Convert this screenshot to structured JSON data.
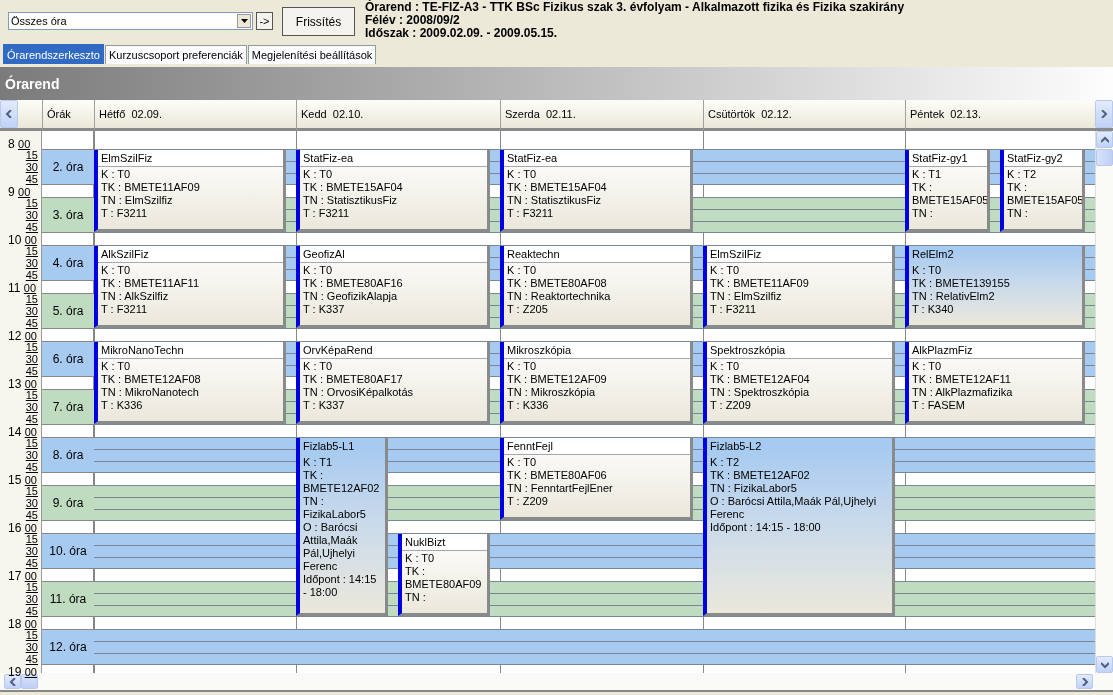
{
  "toolbar": {
    "filter": {
      "value": "Összes óra"
    },
    "go_button": "->",
    "refresh_button": "Frissítés",
    "info": [
      "Órarend : TE-FIZ-A3 - TTK BSc Fizikus szak 3. évfolyam - Alkalmazott fizika és Fizika szakirány",
      "Félév : 2008/09/2",
      "Időszak : 2009.02.09. - 2009.05.15."
    ]
  },
  "tabs": [
    {
      "label": "Órarendszerkeszto",
      "selected": true
    },
    {
      "label": "Kurzuscsoport preferenciák",
      "selected": false
    },
    {
      "label": "Megjelenítési beállítások",
      "selected": false
    }
  ],
  "panel_title": "Órarend",
  "timetable": {
    "periods_heading": "Órák",
    "hours": [
      {
        "hour": "8",
        "minute": "00",
        "quarters": [
          "15",
          "30",
          "45"
        ]
      },
      {
        "hour": "9",
        "minute": "00",
        "quarters": [
          "15",
          "30",
          "45"
        ]
      },
      {
        "hour": "10",
        "minute": "00",
        "quarters": [
          "15",
          "30",
          "45"
        ]
      },
      {
        "hour": "11",
        "minute": "00",
        "quarters": [
          "15",
          "30",
          "45"
        ]
      },
      {
        "hour": "12",
        "minute": "00",
        "quarters": [
          "15",
          "30",
          "45"
        ]
      },
      {
        "hour": "13",
        "minute": "00",
        "quarters": [
          "15",
          "30",
          "45"
        ]
      },
      {
        "hour": "14",
        "minute": "00",
        "quarters": [
          "15",
          "30",
          "45"
        ]
      },
      {
        "hour": "15",
        "minute": "00",
        "quarters": [
          "15",
          "30",
          "45"
        ]
      },
      {
        "hour": "16",
        "minute": "00",
        "quarters": [
          "15",
          "30",
          "45"
        ]
      },
      {
        "hour": "17",
        "minute": "00",
        "quarters": [
          "15",
          "30",
          "45"
        ]
      },
      {
        "hour": "18",
        "minute": "00",
        "quarters": [
          "15",
          "30",
          "45"
        ]
      },
      {
        "hour": "19",
        "minute": "00"
      }
    ],
    "periods": [
      {
        "label": "2. óra",
        "color": "#a6caf0"
      },
      {
        "label": "3. óra",
        "color": "#c0dcc0"
      },
      {
        "label": "4. óra",
        "color": "#a6caf0"
      },
      {
        "label": "5. óra",
        "color": "#c0dcc0"
      },
      {
        "label": "6. óra",
        "color": "#a6caf0"
      },
      {
        "label": "7. óra",
        "color": "#c0dcc0"
      },
      {
        "label": "8. óra",
        "color": "#a6caf0"
      },
      {
        "label": "9. óra",
        "color": "#c0dcc0"
      },
      {
        "label": "10. óra",
        "color": "#a6caf0"
      },
      {
        "label": "11. óra",
        "color": "#c0dcc0"
      },
      {
        "label": "12. óra",
        "color": "#a6caf0"
      }
    ],
    "days": [
      {
        "name": "Hétfő",
        "date": "02.09.",
        "blocks": [
          {
            "kind": "booked",
            "events": [
              {
                "title": "ElmSzilFiz",
                "kind": "double",
                "highlighted": false,
                "lines": [
                  "K : T0",
                  "TK : BMETE11AF09",
                  "TN : ElmSzilfiz",
                  "T : F3211"
                ]
              }
            ]
          },
          {
            "kind": "booked",
            "events": [
              {
                "title": "AlkSzilFiz",
                "kind": "double",
                "highlighted": false,
                "lines": [
                  "K : T0",
                  "TK : BMETE11AF11",
                  "TN : AlkSzilfiz",
                  "T : F3211"
                ]
              }
            ]
          },
          {
            "kind": "booked",
            "events": [
              {
                "title": "MikroNanoTechn",
                "kind": "double",
                "highlighted": false,
                "lines": [
                  "K : T0",
                  "TK : BMETE12AF08",
                  "TN : MikroNanotech",
                  "T : K336"
                ]
              }
            ]
          }
        ]
      },
      {
        "name": "Kedd",
        "date": "02.10.",
        "blocks": [
          {
            "kind": "booked",
            "events": [
              {
                "title": "StatFiz-ea",
                "kind": "double",
                "highlighted": false,
                "lines": [
                  "K : T0",
                  "TK : BMETE15AF04",
                  "TN : StatisztikusFiz",
                  "T : F3211"
                ]
              }
            ]
          },
          {
            "kind": "booked",
            "events": [
              {
                "title": "GeofizAl",
                "kind": "double",
                "highlighted": false,
                "lines": [
                  "K : T0",
                  "TK : BMETE80AF16",
                  "TN : GeofizikAlapja",
                  "T : K337"
                ]
              }
            ]
          },
          {
            "kind": "booked",
            "events": [
              {
                "title": "OrvKépaRend",
                "kind": "double",
                "highlighted": false,
                "lines": [
                  "K : T0",
                  "TK : BMETE80AF17",
                  "TN : OrvosiKépalkotás",
                  "T : K337"
                ]
              }
            ]
          },
          {
            "kind": "booked",
            "events": [
              {
                "title": "Fizlab5-L1",
                "kind": "quadruple",
                "highlighted": true,
                "lines": [
                  "K : T1",
                  "TK : BMETE12AF02",
                  "TN : FizikaLabor5",
                  "O : Barócsi Attila,Maák Pál,Ujhelyi Ferenc",
                  "Időpont : 14:15 - 18:00"
                ]
              }
            ]
          },
          {
            "kind": "booked",
            "events": [
              {
                "title": "NuklBizt",
                "kind": "double",
                "highlighted": false,
                "lines": [
                  "K : T0",
                  "TK : BMETE80AF09",
                  "TN :"
                ]
              }
            ]
          }
        ]
      },
      {
        "name": "Szerda",
        "date": "02.11.",
        "blocks": [
          {
            "kind": "booked",
            "events": [
              {
                "title": "StatFiz-ea",
                "kind": "double",
                "highlighted": false,
                "lines": [
                  "K : T0",
                  "TK : BMETE15AF04",
                  "TN : StatisztikusFiz",
                  "T : F3211"
                ]
              }
            ]
          },
          {
            "kind": "booked",
            "events": [
              {
                "title": "Reaktechn",
                "kind": "double",
                "highlighted": false,
                "lines": [
                  "K : T0",
                  "TK : BMETE80AF08",
                  "TN : Reaktortechnika",
                  "T : Z205"
                ]
              }
            ]
          },
          {
            "kind": "booked",
            "events": [
              {
                "title": "Mikroszkópia",
                "kind": "double",
                "highlighted": false,
                "lines": [
                  "K : T0",
                  "TK : BMETE12AF09",
                  "TN : Mikroszkópia",
                  "T : K336"
                ]
              }
            ]
          },
          {
            "kind": "booked",
            "events": [
              {
                "title": "FenntFejl",
                "kind": "double",
                "highlighted": false,
                "lines": [
                  "K : T0",
                  "TK : BMETE80AF06",
                  "TN : FenntartFejlEner",
                  "T : Z209"
                ]
              }
            ]
          }
        ]
      },
      {
        "name": "Csütörtök",
        "date": "02.12.",
        "blocks": [
          {
            "kind": "free"
          },
          {
            "kind": "booked",
            "events": [
              {
                "title": "ElmSzilFiz",
                "kind": "double",
                "highlighted": false,
                "lines": [
                  "K : T0",
                  "TK : BMETE11AF09",
                  "TN : ElmSzilfiz",
                  "T : F3211"
                ]
              }
            ]
          },
          {
            "kind": "booked",
            "events": [
              {
                "title": "Spektroszkópia",
                "kind": "double",
                "highlighted": false,
                "lines": [
                  "K : T0",
                  "TK : BMETE12AF04",
                  "TN : Spektroszkópia",
                  "T : Z209"
                ]
              }
            ]
          },
          {
            "kind": "booked",
            "events": [
              {
                "title": "Fizlab5-L2",
                "kind": "quadruple",
                "highlighted": true,
                "lines": [
                  "K : T2",
                  "TK : BMETE12AF02",
                  "TN : FizikaLabor5",
                  "O : Barócsi Attila,Maák Pál,Ujhelyi Ferenc",
                  "Időpont : 14:15 - 18:00"
                ]
              }
            ]
          }
        ]
      },
      {
        "name": "Péntek",
        "date": "02.13.",
        "blocks": [
          {
            "kind": "booked",
            "events": [
              {
                "title": "StatFiz-gy1",
                "kind": "double",
                "highlighted": false,
                "lines": [
                  "K : T1",
                  "TK : BMETE15AF05",
                  "TN :"
                ]
              },
              {
                "title": "StatFiz-gy2",
                "kind": "double",
                "highlighted": false,
                "lines": [
                  "K : T2",
                  "TK : BMETE15AF05",
                  "TN :"
                ]
              }
            ]
          },
          {
            "kind": "booked",
            "events": [
              {
                "title": "RelElm2",
                "kind": "double",
                "highlighted": true,
                "lines": [
                  "K : T0",
                  "TK : BMETE139155",
                  "TN : RelativElm2",
                  "T : K340"
                ]
              }
            ]
          },
          {
            "kind": "booked",
            "events": [
              {
                "title": "AlkPlazmFiz",
                "kind": "double",
                "highlighted": false,
                "lines": [
                  "K : T0",
                  "TK : BMETE12AF11",
                  "TN : AlkPlazmafizika",
                  "T : FASEM"
                ]
              }
            ]
          }
        ]
      }
    ]
  }
}
